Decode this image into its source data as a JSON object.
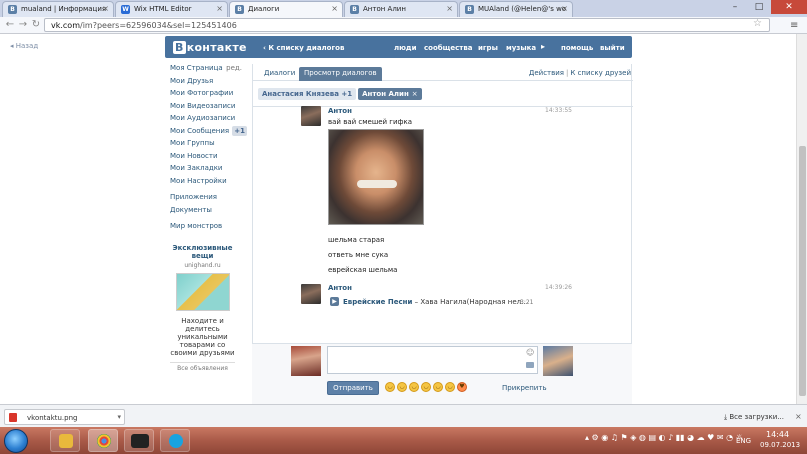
{
  "browser": {
    "tabs": [
      {
        "label": "mualand | Информация",
        "favicon": "vk-icon",
        "color": "#5b7fa6"
      },
      {
        "label": "Wix HTML Editor",
        "favicon": "wix-icon",
        "color": "#2a6cd6"
      },
      {
        "label": "Диалоги",
        "favicon": "vk-icon",
        "color": "#5b7fa6"
      },
      {
        "label": "Антон Алин",
        "favicon": "vk-icon",
        "color": "#5b7fa6"
      },
      {
        "label": "MUAland (@Helen@'s wo",
        "favicon": "vk-icon",
        "color": "#5b7fa6"
      }
    ],
    "url_host": "vk.com",
    "url_path": "/im?peers=62596034&sel=125451406"
  },
  "vk": {
    "back": "Назад",
    "logo": "контакте",
    "logo_letter": "В",
    "back_to_list": "К списку диалогов",
    "nav": [
      "люди",
      "сообщества",
      "игры",
      "музыка",
      "помощь",
      "выйти"
    ],
    "menu": [
      {
        "label": "Моя Страница",
        "extra": "ред."
      },
      {
        "label": "Мои Друзья"
      },
      {
        "label": "Мои Фотографии"
      },
      {
        "label": "Мои Видеозаписи"
      },
      {
        "label": "Мои Аудиозаписи"
      },
      {
        "label": "Мои Сообщения",
        "badge": "+1"
      },
      {
        "label": "Мои Группы"
      },
      {
        "label": "Мои Новости"
      },
      {
        "label": "Мои Закладки"
      },
      {
        "label": "Мои Настройки"
      },
      {
        "label": "Приложения"
      },
      {
        "label": "Документы"
      },
      {
        "label": "Мир монстров"
      }
    ],
    "ad": {
      "title": "Эксклюзивные вещи",
      "domain": "unighand.ru",
      "text": "Находите и делитесь уникальными товарами со своими друзьями",
      "all": "Все объявления"
    },
    "tabs": [
      "Диалоги",
      "Просмотр диалогов"
    ],
    "actions": "Действия",
    "to_friends": "К списку друзей",
    "peers": [
      {
        "name": "Анастасия Князева",
        "count": "+1"
      },
      {
        "name": "Антон Алин"
      }
    ],
    "messages": [
      {
        "author": "Антон",
        "time": "14:33:55",
        "lines": [
          "вай вай смешей гифка",
          "шельма старая",
          "ответь мне сука",
          "еврейская шельма"
        ]
      },
      {
        "author": "Антон",
        "time": "14:39:26",
        "audio": {
          "artist": "Еврейские Песни",
          "dash": "–",
          "title": "Хава Нагила(Народная нел...",
          "duration": "3:21"
        }
      }
    ],
    "send": "Отправить",
    "attach": "Прикрепить"
  },
  "downloads": {
    "file": "vkontaktu.png",
    "all": "Все загрузки..."
  },
  "taskbar": {
    "lang": "ENG",
    "time": "14:44",
    "date": "09.07.2013"
  }
}
